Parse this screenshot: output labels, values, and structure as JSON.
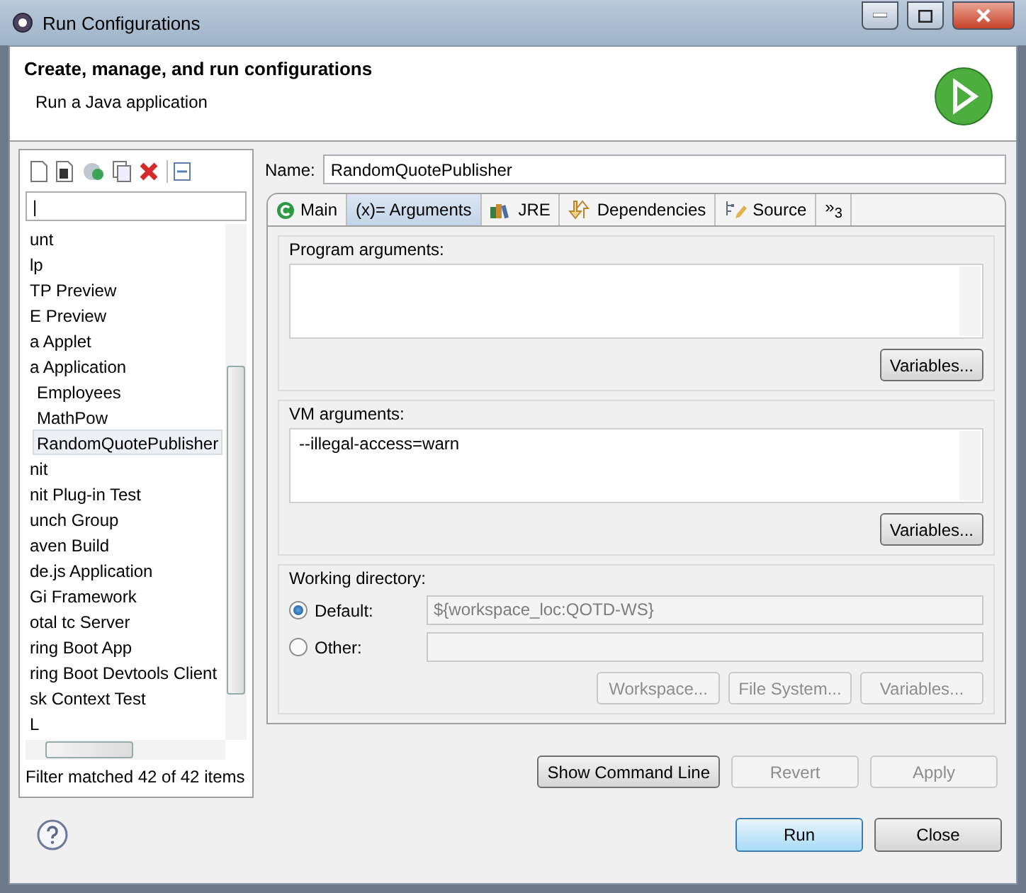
{
  "window": {
    "title": "Run Configurations"
  },
  "header": {
    "title": "Create, manage, and run configurations",
    "subtitle": "Run a Java application"
  },
  "filter": {
    "value": "|"
  },
  "tree": [
    {
      "label": "unt",
      "selected": false
    },
    {
      "label": "lp",
      "selected": false
    },
    {
      "label": "TP Preview",
      "selected": false
    },
    {
      "label": "E Preview",
      "selected": false
    },
    {
      "label": "a Applet",
      "selected": false
    },
    {
      "label": "a Application",
      "selected": false,
      "children": [
        {
          "label": "Employees",
          "selected": false
        },
        {
          "label": "MathPow",
          "selected": false
        },
        {
          "label": "RandomQuotePublisher",
          "selected": true
        }
      ]
    },
    {
      "label": "nit",
      "selected": false
    },
    {
      "label": "nit Plug-in Test",
      "selected": false
    },
    {
      "label": "unch Group",
      "selected": false
    },
    {
      "label": "aven Build",
      "selected": false
    },
    {
      "label": "de.js Application",
      "selected": false
    },
    {
      "label": "Gi Framework",
      "selected": false
    },
    {
      "label": "otal tc Server",
      "selected": false
    },
    {
      "label": "ring Boot App",
      "selected": false
    },
    {
      "label": "ring Boot Devtools Client",
      "selected": false
    },
    {
      "label": "sk Context Test",
      "selected": false
    },
    {
      "label": "L",
      "selected": false
    }
  ],
  "filter_status": "Filter matched 42 of 42 items",
  "name": {
    "label": "Name:",
    "value": "RandomQuotePublisher"
  },
  "tabs": [
    {
      "label": "Main",
      "kind": "main",
      "selected": false
    },
    {
      "label": "(x)= Arguments",
      "kind": "arguments",
      "selected": true
    },
    {
      "label": "JRE",
      "kind": "jre",
      "selected": false
    },
    {
      "label": "Dependencies",
      "kind": "dependencies",
      "selected": false
    },
    {
      "label": "Source",
      "kind": "source",
      "selected": false
    },
    {
      "label": "»$_{3}$",
      "kind": "overflow",
      "selected": false
    }
  ],
  "program_arguments": {
    "label": "Program arguments:",
    "button": {
      "label": "Variables...",
      "disabled": false
    }
  },
  "vm_arguments": {
    "label": "VM arguments:",
    "value": "--illegal-access=warn",
    "button": {
      "label": "Variables...",
      "disabled": false
    }
  },
  "working_directory": {
    "label": "Working directory:",
    "options": [
      {
        "label": "Default:",
        "selected": true,
        "value": "${workspace_loc:QOTD-WS}"
      },
      {
        "label": "Other:",
        "selected": false
      }
    ],
    "buttons": [
      {
        "label": "Workspace...",
        "disabled": true
      },
      {
        "label": "File System...",
        "disabled": true
      },
      {
        "label": "Variables...",
        "disabled": true
      }
    ]
  },
  "actions": [
    {
      "label": "Show Command Line",
      "disabled": false
    },
    {
      "label": "Revert",
      "disabled": true
    },
    {
      "label": "Apply",
      "disabled": true
    }
  ],
  "footer": [
    {
      "label": "Run",
      "kind": "default"
    },
    {
      "label": "Close",
      "kind": "normal"
    }
  ]
}
